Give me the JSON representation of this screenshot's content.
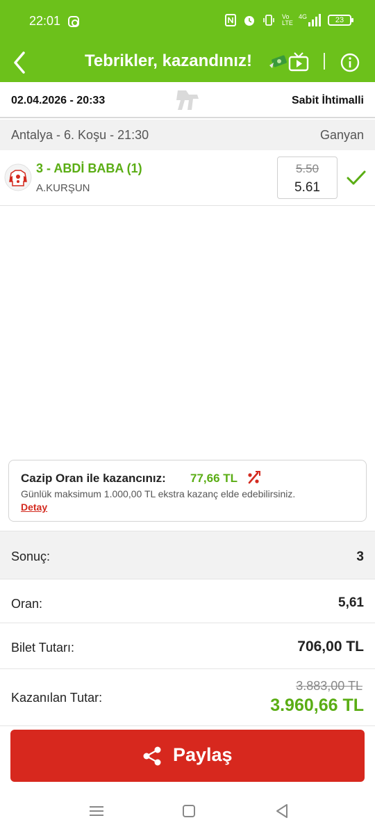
{
  "status_bar": {
    "time": "22:01",
    "icons": [
      "instagram-icon",
      "nfc-icon",
      "alarm-icon",
      "vibrate-icon",
      "volte-icon",
      "4g-signal-icon",
      "battery-icon"
    ],
    "volte_label": "Vo LTE",
    "network_label": "4G",
    "battery_level": "23"
  },
  "header": {
    "title": "Tebrikler, kazandınız!",
    "icons": [
      "back-arrow-icon",
      "money-wings-icon",
      "tv-play-icon",
      "info-icon"
    ],
    "background_color": "#6cc11b"
  },
  "race_info": {
    "datetime": "02.04.2026 - 20:33",
    "bet_type": "Sabit İhtimalli"
  },
  "race": {
    "name": "Antalya - 6. Koşu - 21:30",
    "bet_kind": "Ganyan"
  },
  "selection": {
    "horse": "3 - ABDİ BABA (1)",
    "jockey": "A.KURŞUN",
    "odds_old": "5.50",
    "odds_new": "5.61",
    "status": "won"
  },
  "promo": {
    "title": "Cazip Oran ile kazancınız:",
    "amount": "77,66 TL",
    "description": "Günlük maksimum 1.000,00 TL ekstra kazanç elde edebilirsiniz.",
    "link": "Detay"
  },
  "summary": {
    "result_label": "Sonuç:",
    "result_value": "3",
    "odds_label": "Oran:",
    "odds_value": "5,61",
    "ticket_label": "Bilet Tutarı:",
    "ticket_value": "706,00 TL",
    "won_label": "Kazanılan Tutar:",
    "won_old": "3.883,00 TL",
    "won_value": "3.960,66 TL"
  },
  "share": {
    "label": "Paylaş",
    "color": "#d7281e"
  },
  "nav": {
    "icons": [
      "recent-apps-icon",
      "home-icon",
      "back-icon"
    ]
  },
  "colors": {
    "accent_green": "#5aad14",
    "alert_red": "#d32a1f"
  }
}
